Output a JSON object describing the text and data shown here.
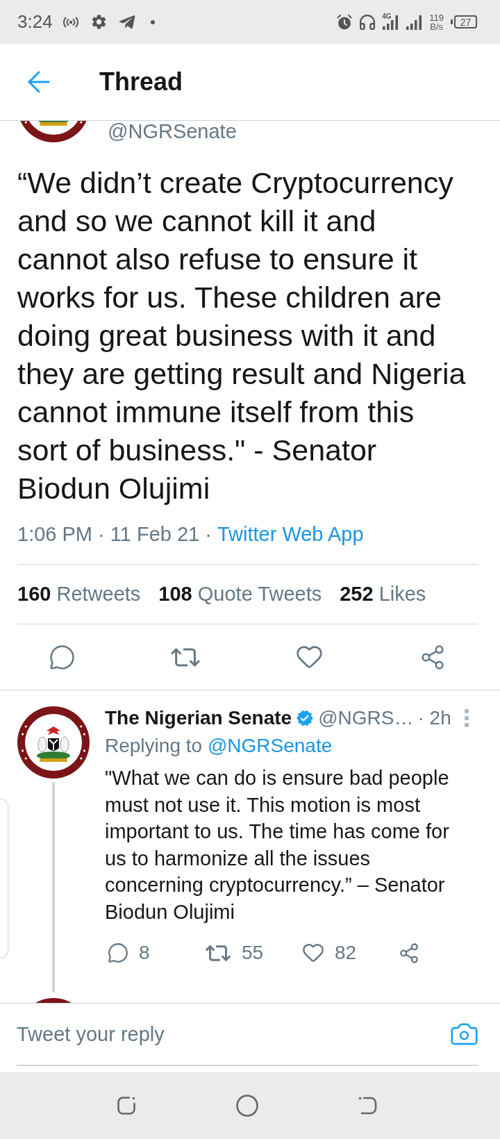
{
  "status_bar": {
    "time": "3:24",
    "network_type": "4G",
    "speed": "119",
    "speed_unit": "B/s",
    "battery": "27"
  },
  "header": {
    "title": "Thread"
  },
  "main_tweet": {
    "handle": "@NGRSenate",
    "text": "“We didn’t create Cryptocurrency and so we cannot kill it and cannot also refuse to ensure it works for us. These children are doing great business with it and they are getting result and Nigeria cannot immune itself from this sort of business.\" - Senator Biodun Olujimi",
    "timestamp": "1:06 PM · 11 Feb 21 ·",
    "source": "Twitter Web App",
    "stats": [
      {
        "count": "160",
        "label": "Retweets"
      },
      {
        "count": "108",
        "label": "Quote Tweets"
      },
      {
        "count": "252",
        "label": "Likes"
      }
    ],
    "actions": [
      {
        "kind": "reply"
      },
      {
        "kind": "retweet"
      },
      {
        "kind": "like"
      },
      {
        "kind": "share"
      }
    ]
  },
  "replies": [
    {
      "name": "The Nigerian Senate",
      "verified": true,
      "handle": "@NGRS…",
      "time": "· 2h",
      "replying_label": "Replying to",
      "replying_to": "@NGRSenate",
      "text": "\"What we can do is ensure bad people must not use it. This motion is most important to us. The time has come for us to harmonize all the issues concerning cryptocurrency.” – Senator Biodun Olujimi",
      "actions": [
        {
          "kind": "reply",
          "count": "8"
        },
        {
          "kind": "retweet",
          "count": "55"
        },
        {
          "kind": "like",
          "count": "82"
        },
        {
          "kind": "share"
        }
      ]
    }
  ],
  "composer": {
    "placeholder": "Tweet your reply"
  }
}
